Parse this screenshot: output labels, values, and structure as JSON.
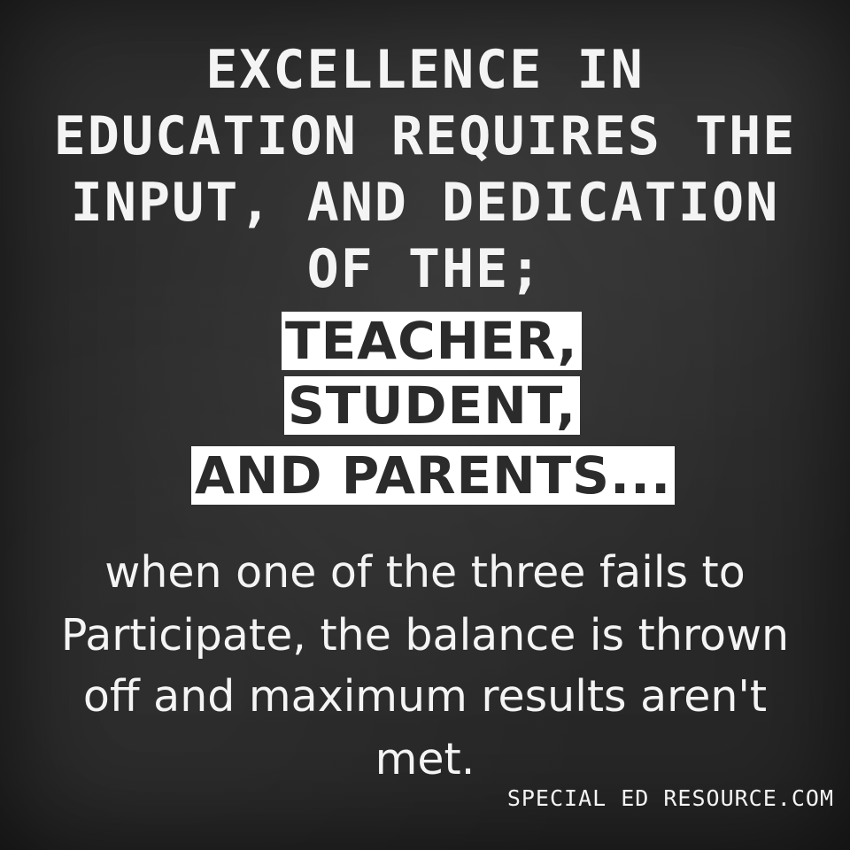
{
  "background_color": "#2a2a2a",
  "text_color": "#f4f4f4",
  "highlight_background": "#ffffff",
  "highlight_text_color": "#2b2b2b",
  "heading_lines": [
    "EXCELLENCE IN",
    "EDUCATION REQUIRES THE",
    "INPUT, AND DEDICATION",
    "OF THE;"
  ],
  "highlight_lines": [
    "TEACHER,",
    "STUDENT,",
    "AND PARENTS..."
  ],
  "body_lines": [
    "when one of the three fails to",
    "Participate, the balance is thrown",
    "off and maximum results aren't",
    "met."
  ],
  "credit": "SPECIAL ED RESOURCE.COM"
}
